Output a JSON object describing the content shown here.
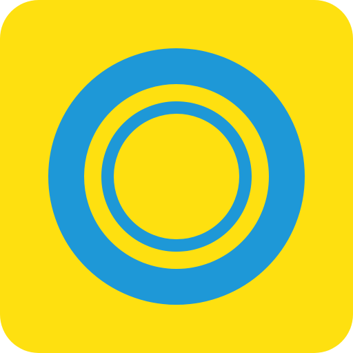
{
  "app_icon": {
    "icon": "concentric-rings-icon",
    "colors": {
      "background": "#FEE010",
      "ring": "#1E98D7",
      "page": "#FFFFFF"
    }
  }
}
